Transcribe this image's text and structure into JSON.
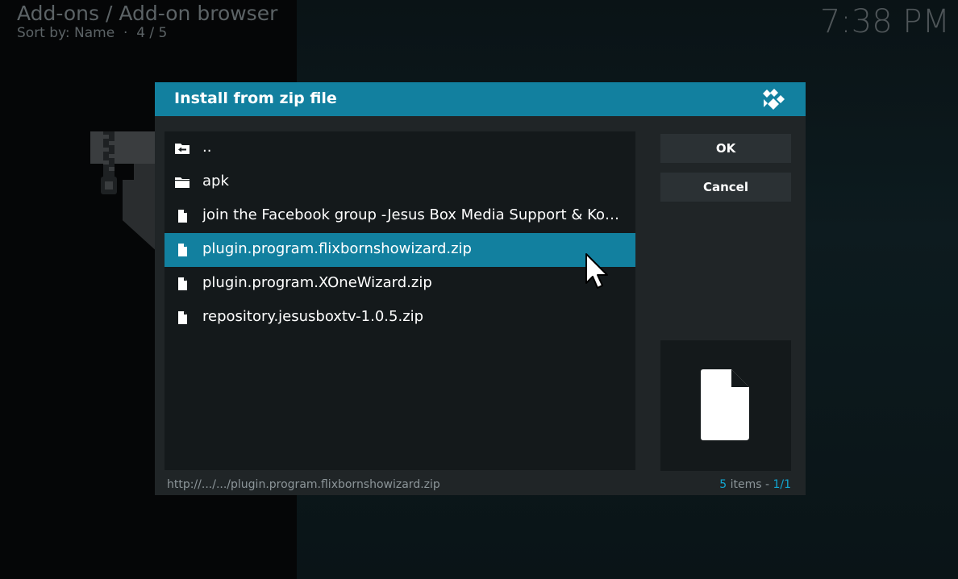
{
  "header": {
    "title": "Add-ons / Add-on browser",
    "sort_by": "Sort by: Name",
    "separator": "·",
    "position": "4 / 5"
  },
  "clock": "7:38 PM",
  "dialog": {
    "title": "Install from zip file",
    "logo_icon": "kodi-logo-icon",
    "items": [
      {
        "label": "..",
        "icon": "folder-back-icon"
      },
      {
        "label": "apk",
        "icon": "folder-icon"
      },
      {
        "label": "join the Facebook group -Jesus Box Media Support & Ko…",
        "icon": "file-icon"
      },
      {
        "label": "plugin.program.flixbornshowizard.zip",
        "icon": "file-icon",
        "selected": true
      },
      {
        "label": "plugin.program.XOneWizard.zip",
        "icon": "file-icon"
      },
      {
        "label": "repository.jesusboxtv-1.0.5.zip",
        "icon": "file-icon"
      }
    ],
    "buttons": {
      "ok": "OK",
      "cancel": "Cancel"
    },
    "path": "http://.../.../plugin.program.flixbornshowizard.zip",
    "counter": {
      "count": "5",
      "items_label": " items - ",
      "page": "1/1"
    },
    "accent_color": "#12809f"
  }
}
